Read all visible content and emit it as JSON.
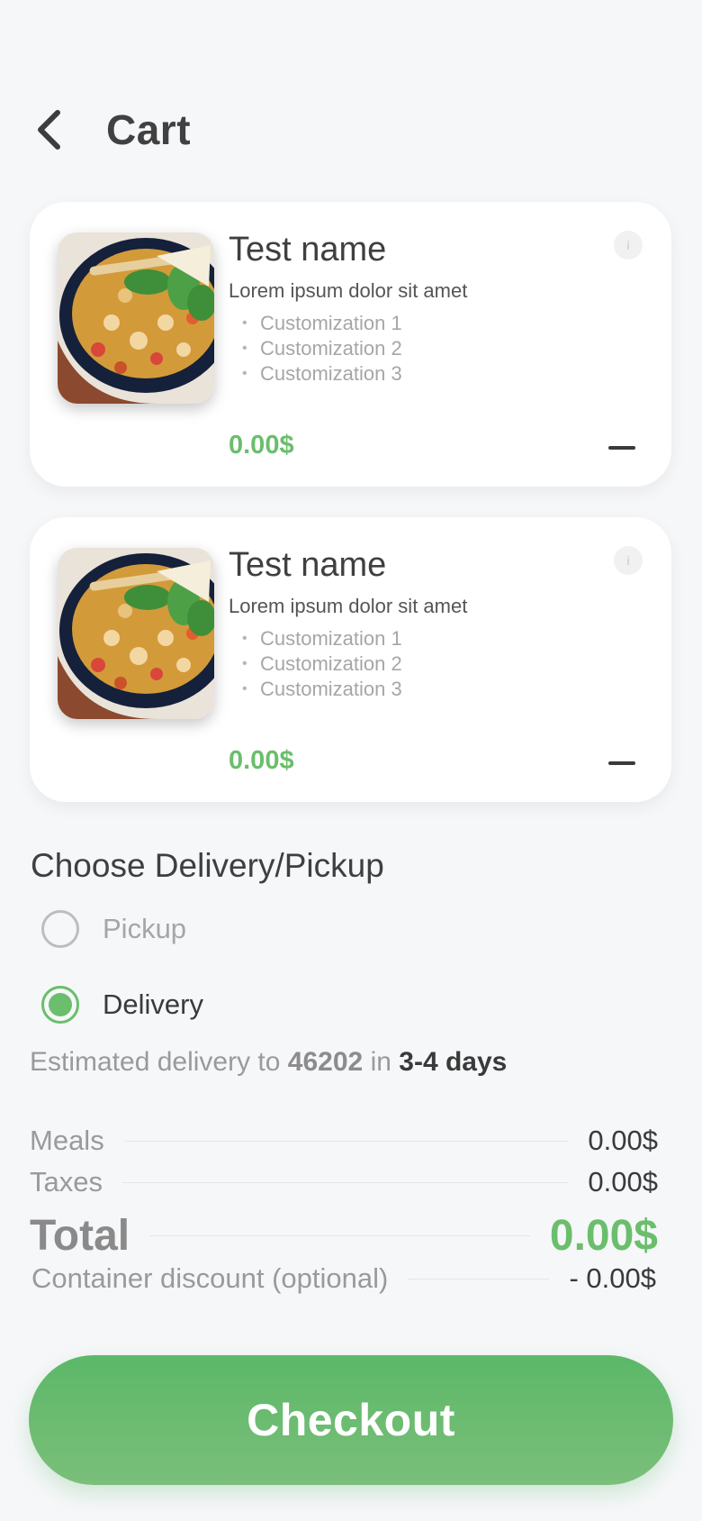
{
  "header": {
    "title": "Cart",
    "back_icon": "chevron-left-icon"
  },
  "cart_items": [
    {
      "name": "Test name",
      "description": "Lorem ipsum dolor sit amet",
      "customizations": [
        "Customization 1",
        "Customization 2",
        "Customization 3"
      ],
      "price": "0.00$",
      "info_label": "i",
      "image": "food-bowl-image",
      "remove_icon": "minus-icon"
    },
    {
      "name": "Test name",
      "description": "Lorem ipsum dolor sit amet",
      "customizations": [
        "Customization 1",
        "Customization 2",
        "Customization 3"
      ],
      "price": "0.00$",
      "info_label": "i",
      "image": "food-bowl-image",
      "remove_icon": "minus-icon"
    }
  ],
  "delivery": {
    "title": "Choose Delivery/Pickup",
    "options": [
      {
        "label": "Pickup",
        "selected": false
      },
      {
        "label": "Delivery",
        "selected": true
      }
    ],
    "estimate_prefix": "Estimated delivery to",
    "zip": "46202",
    "estimate_mid": "in",
    "days": "3-4 days"
  },
  "summary": {
    "meals_label": "Meals",
    "meals_value": "0.00$",
    "taxes_label": "Taxes",
    "taxes_value": "0.00$",
    "total_label": "Total",
    "total_value": "0.00$",
    "discount_label": "Container discount (optional)",
    "discount_value": "- 0.00$"
  },
  "checkout_label": "Checkout",
  "colors": {
    "accent": "#6abe6c",
    "background": "#f6f7f9",
    "card": "#ffffff"
  }
}
